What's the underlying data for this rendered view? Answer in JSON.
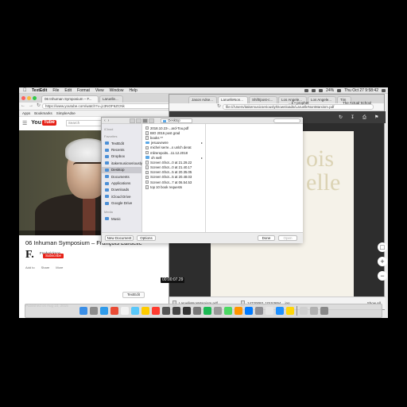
{
  "menubar": {
    "app_name": "TextEdit",
    "items": [
      "File",
      "Edit",
      "Format",
      "View",
      "Window",
      "Help"
    ],
    "clock": "Thu Oct 27  9:58:42",
    "battery": "24%"
  },
  "youtube_browser": {
    "tabs": [
      {
        "label": "06 Inhuman Symposium – F..."
      },
      {
        "label": "Laruelle..."
      }
    ],
    "url": "https://www.youtube.com/watch?v=jc3NOF6ZCNk",
    "bookmarks": [
      "Apps",
      "Bookmarks",
      "SimpleAdse"
    ],
    "logo_text": "You",
    "logo_tube": "Tube",
    "search_placeholder": "Search",
    "video_title": "06 Inhuman Symposium – François Laruelle",
    "channel_name": "Frederickson",
    "channel_logo": "F.",
    "subscribe_label": "Subscribe",
    "actions": [
      "Add to",
      "Share",
      "More"
    ],
    "published": "Published on Aug 10, 2015",
    "timestamp": "00:00:07.29",
    "textedit_button": "TextEdit"
  },
  "pdf_browser": {
    "tabs": [
      {
        "label": "Jason Adse..."
      },
      {
        "label": "LaruelleNon..."
      },
      {
        "label": "Shift/post-c..."
      },
      {
        "label": "Los Angele..."
      },
      {
        "label": "Los Angele..."
      },
      {
        "label": "Tim"
      }
    ],
    "url": "file:///Users/itakemusicseriously/Downloads/LaruelleNonMarxism.pdf",
    "bookmarks_right": [
      "...k • prophet",
      "The Actual School"
    ],
    "page_text": "ois\nelle",
    "downloads": [
      "LaruelleNonMarxism.pdf",
      "14720093_10153654....jpg"
    ],
    "show_all": "Show All"
  },
  "open_dialog": {
    "location": "Desktop",
    "sidebar": {
      "icloud_header": "iCloud",
      "favorites_header": "Favorites",
      "media_header": "Media",
      "favorites": [
        {
          "label": "TextEdit",
          "selected": false
        },
        {
          "label": "Recents",
          "selected": false
        },
        {
          "label": "Dropbox",
          "selected": false
        },
        {
          "label": "itakemusicseriously",
          "selected": false
        },
        {
          "label": "Desktop",
          "selected": true
        },
        {
          "label": "Documents",
          "selected": false
        },
        {
          "label": "Applications",
          "selected": false
        },
        {
          "label": "Downloads",
          "selected": false
        },
        {
          "label": "iCloud Drive",
          "selected": false
        },
        {
          "label": "Google Drive",
          "selected": false
        }
      ],
      "media": [
        {
          "label": "Music"
        }
      ]
    },
    "files": [
      {
        "name": "2018.10.23-...ard-Tou.pdf",
        "folder": false,
        "has_arrow": false
      },
      {
        "name": "BIO 2016 post grad",
        "folder": false,
        "has_arrow": false
      },
      {
        "name": "books **",
        "folder": false,
        "has_arrow": false
      },
      {
        "name": "jesuuvewre",
        "folder": true,
        "has_arrow": true
      },
      {
        "name": "michel serre...s unlch derat",
        "folder": false,
        "has_arrow": false
      },
      {
        "name": "mlirerepoits...11.12.2018",
        "folder": false,
        "has_arrow": false
      },
      {
        "name": "oh well",
        "folder": true,
        "has_arrow": true
      },
      {
        "name": "Screen Shot...0 at 21.29.22",
        "folder": false,
        "has_arrow": false
      },
      {
        "name": "Screen Shot...0 at 21.40.17",
        "folder": false,
        "has_arrow": false
      },
      {
        "name": "Screen Shot...5 at 20.35.05",
        "folder": false,
        "has_arrow": false
      },
      {
        "name": "Screen Shot...5 at 20.48.03",
        "folder": false,
        "has_arrow": false
      },
      {
        "name": "Screen Shot...7 at 06.54.53",
        "folder": false,
        "has_arrow": false
      },
      {
        "name": "top 10 book requests",
        "folder": false,
        "has_arrow": false
      }
    ],
    "new_document_label": "New Document",
    "options_label": "Options",
    "done_label": "Done",
    "open_label": "Open"
  },
  "colors": {
    "youtube_red": "#e62117",
    "selection_gray": "#c9c9cf",
    "folder_blue": "#5aa7e6"
  }
}
